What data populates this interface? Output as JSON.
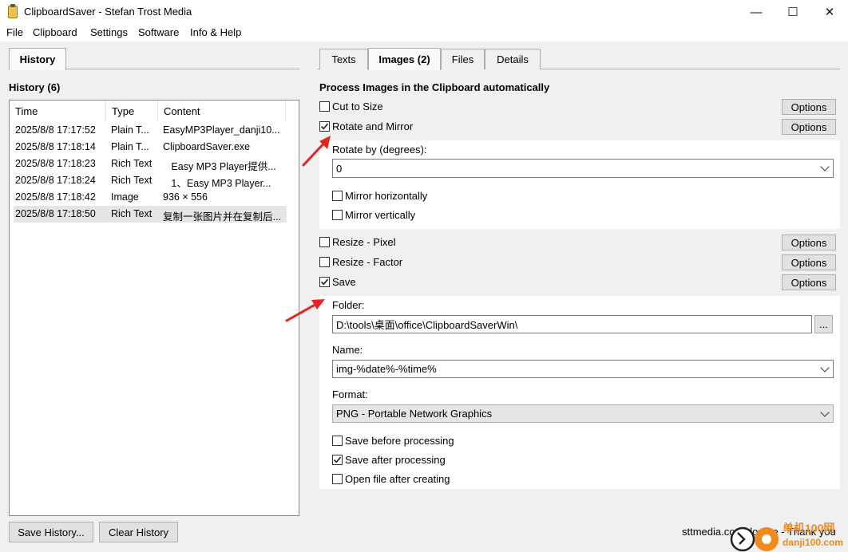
{
  "window": {
    "title": "ClipboardSaver - Stefan Trost Media",
    "minimize": "—",
    "maximize": "☐",
    "close": "✕"
  },
  "menu": [
    "File",
    "Clipboard",
    "Settings",
    "Software",
    "Info & Help"
  ],
  "left_tab": "History",
  "right_tabs": [
    "Texts",
    "Images (2)",
    "Files",
    "Details"
  ],
  "history": {
    "title": "History (6)",
    "columns": [
      "Time",
      "Type",
      "Content"
    ],
    "rows": [
      {
        "time": "2025/8/8 17:17:52",
        "type": "Plain T...",
        "content": "EasyMP3Player_danji10..."
      },
      {
        "time": "2025/8/8 17:18:14",
        "type": "Plain T...",
        "content": "ClipboardSaver.exe"
      },
      {
        "time": "2025/8/8 17:18:23",
        "type": "Rich Text",
        "content": "   Easy MP3 Player提供..."
      },
      {
        "time": "2025/8/8 17:18:24",
        "type": "Rich Text",
        "content": "   1、Easy MP3 Player..."
      },
      {
        "time": "2025/8/8 17:18:42",
        "type": "Image",
        "content": "936 × 556"
      },
      {
        "time": "2025/8/8 17:18:50",
        "type": "Rich Text",
        "content": "复制一张图片并在复制后..."
      }
    ],
    "save_button": "Save History...",
    "clear_button": "Clear History"
  },
  "images": {
    "title": "Process Images in the Clipboard automatically",
    "options_label": "Options",
    "cut_to_size": {
      "label": "Cut to Size",
      "checked": false
    },
    "rotate_mirror": {
      "label": "Rotate and Mirror",
      "checked": true
    },
    "rotate_by_label": "Rotate by (degrees):",
    "rotate_by_value": "0",
    "mirror_h": {
      "label": "Mirror horizontally",
      "checked": false
    },
    "mirror_v": {
      "label": "Mirror vertically",
      "checked": false
    },
    "resize_pixel": {
      "label": "Resize - Pixel",
      "checked": false
    },
    "resize_factor": {
      "label": "Resize - Factor",
      "checked": false
    },
    "save": {
      "label": "Save",
      "checked": true
    },
    "folder_label": "Folder:",
    "folder_value": "D:\\tools\\桌面\\office\\ClipboardSaverWin\\",
    "browse_label": "...",
    "name_label": "Name:",
    "name_value": "img-%date%-%time%",
    "format_label": "Format:",
    "format_value": "PNG - Portable Network Graphics",
    "save_before": {
      "label": "Save before processing",
      "checked": false
    },
    "save_after": {
      "label": "Save after processing",
      "checked": true
    },
    "open_after": {
      "label": "Open file after creating",
      "checked": false
    }
  },
  "footer": {
    "credit": "sttmedia.com/donate - Thank you",
    "watermark_top": "单机100网",
    "watermark_bottom": "danji100.com"
  },
  "colors": {
    "arrow": "#e8231f",
    "watermark": "#f08a1c"
  }
}
